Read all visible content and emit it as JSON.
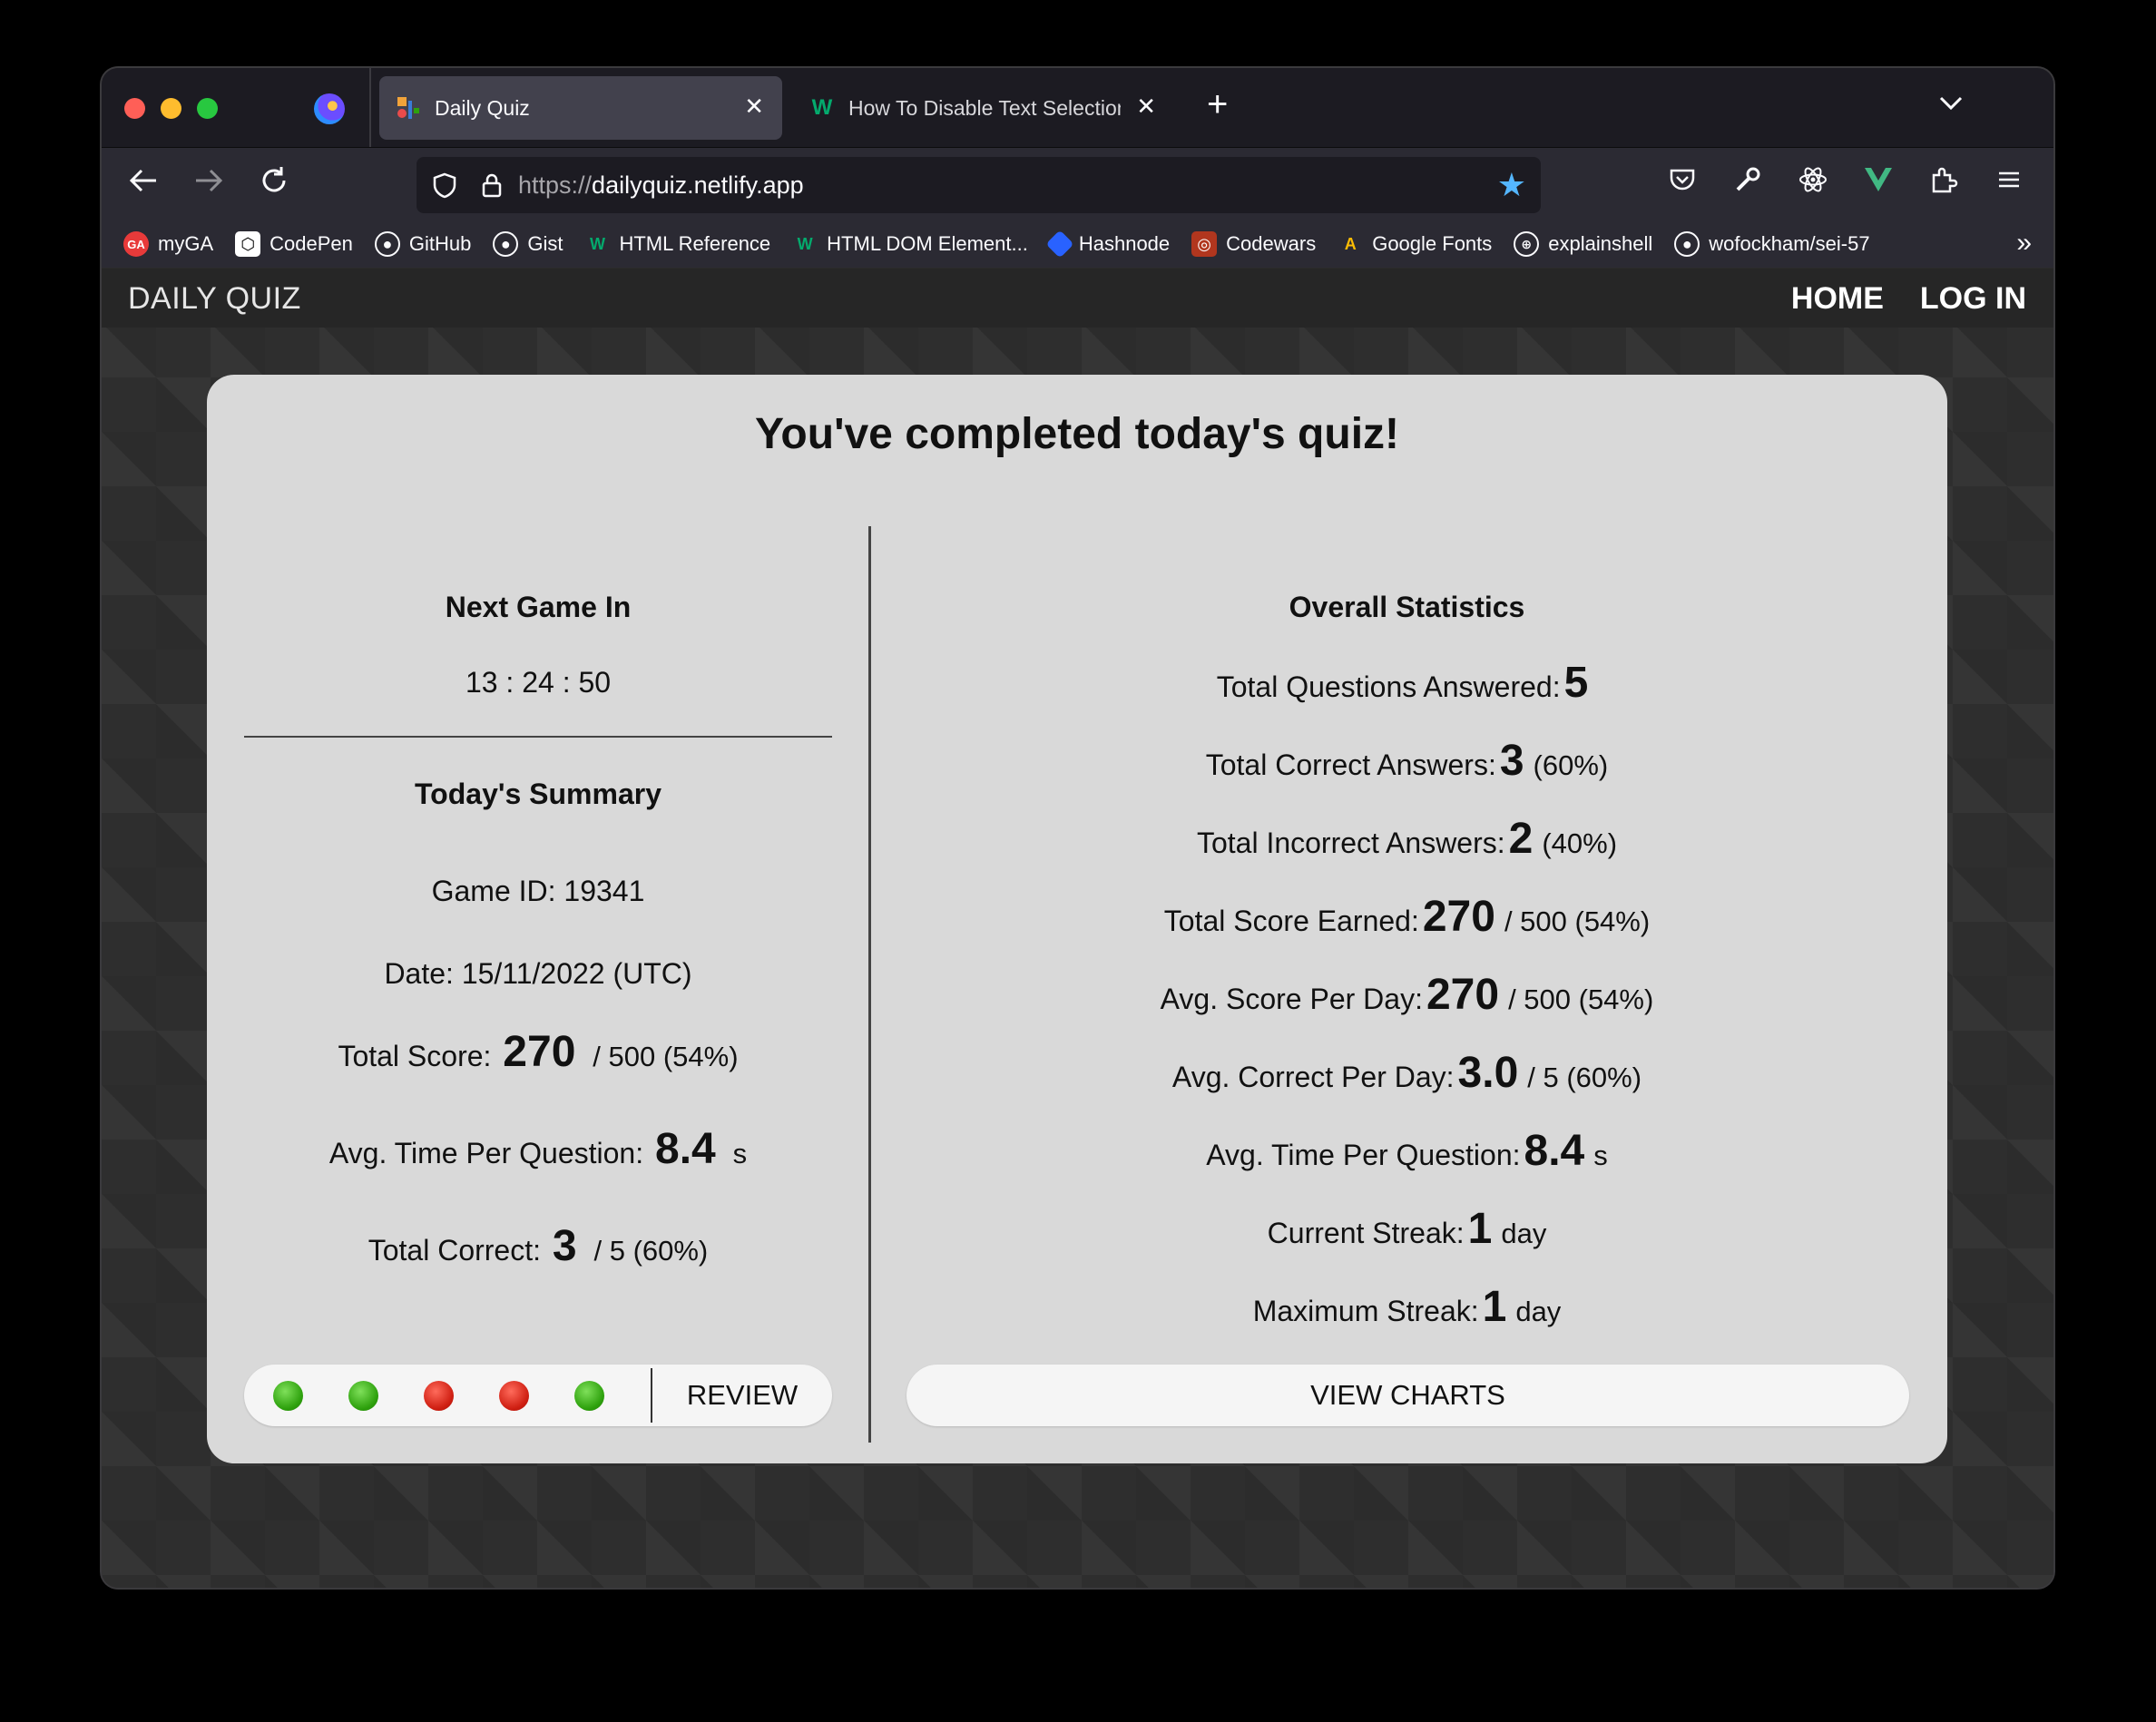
{
  "browser": {
    "tabs": [
      {
        "title": "Daily Quiz",
        "active": true
      },
      {
        "title": "How To Disable Text Selection in",
        "active": false
      }
    ],
    "url_scheme": "https://",
    "url_host": "dailyquiz.netlify.app",
    "bookmarks": [
      {
        "label": "myGA",
        "icon": "GA"
      },
      {
        "label": "CodePen",
        "icon": "codepen-icon"
      },
      {
        "label": "GitHub",
        "icon": "github-icon"
      },
      {
        "label": "Gist",
        "icon": "github-icon"
      },
      {
        "label": "HTML Reference",
        "icon": "w3-icon"
      },
      {
        "label": "HTML DOM Element...",
        "icon": "w3-icon"
      },
      {
        "label": "Hashnode",
        "icon": "hashnode-icon"
      },
      {
        "label": "Codewars",
        "icon": "codewars-icon"
      },
      {
        "label": "Google Fonts",
        "icon": "google-fonts-icon"
      },
      {
        "label": "explainshell",
        "icon": "globe-icon"
      },
      {
        "label": "wofockham/sei-57",
        "icon": "github-icon"
      }
    ]
  },
  "site": {
    "brand": "DAILY QUIZ",
    "nav": {
      "home": "HOME",
      "login": "LOG IN"
    }
  },
  "card": {
    "heading": "You've completed today's quiz!",
    "left": {
      "next_game_title": "Next Game In",
      "countdown": "13 : 24 : 50",
      "summary_title": "Today's Summary",
      "game_id": "Game ID: 19341",
      "date": "Date: 15/11/2022 (UTC)",
      "total_score_label": "Total Score:",
      "total_score_value": "270",
      "total_score_suffix": "/ 500 (54%)",
      "avg_time_label": "Avg. Time Per Question:",
      "avg_time_value": "8.4",
      "avg_time_suffix": "s",
      "total_correct_label": "Total Correct:",
      "total_correct_value": "3",
      "total_correct_suffix": "/ 5 (60%)",
      "results": [
        "correct",
        "correct",
        "incorrect",
        "incorrect",
        "correct"
      ],
      "review_label": "REVIEW"
    },
    "right": {
      "title": "Overall Statistics",
      "stats": [
        {
          "label": "Total Questions Answered:",
          "value": "5",
          "suffix": ""
        },
        {
          "label": "Total Correct Answers:",
          "value": "3",
          "suffix": "(60%)"
        },
        {
          "label": "Total Incorrect Answers:",
          "value": "2",
          "suffix": "(40%)"
        },
        {
          "label": "Total Score Earned:",
          "value": "270",
          "suffix": "/ 500 (54%)"
        },
        {
          "label": "Avg. Score Per Day:",
          "value": "270",
          "suffix": "/ 500 (54%)"
        },
        {
          "label": "Avg. Correct Per Day:",
          "value": "3.0",
          "suffix": "/ 5 (60%)"
        },
        {
          "label": "Avg. Time Per Question:",
          "value": "8.4",
          "suffix": "s"
        },
        {
          "label": "Current Streak:",
          "value": "1",
          "suffix": "day"
        },
        {
          "label": "Maximum Streak:",
          "value": "1",
          "suffix": "day"
        }
      ],
      "view_charts_label": "VIEW CHARTS"
    }
  },
  "colors": {
    "correct": "#2ea10d",
    "incorrect": "#cf1f12",
    "bookmark_star": "#54b6ff",
    "card_bg": "#d9d9d9"
  }
}
